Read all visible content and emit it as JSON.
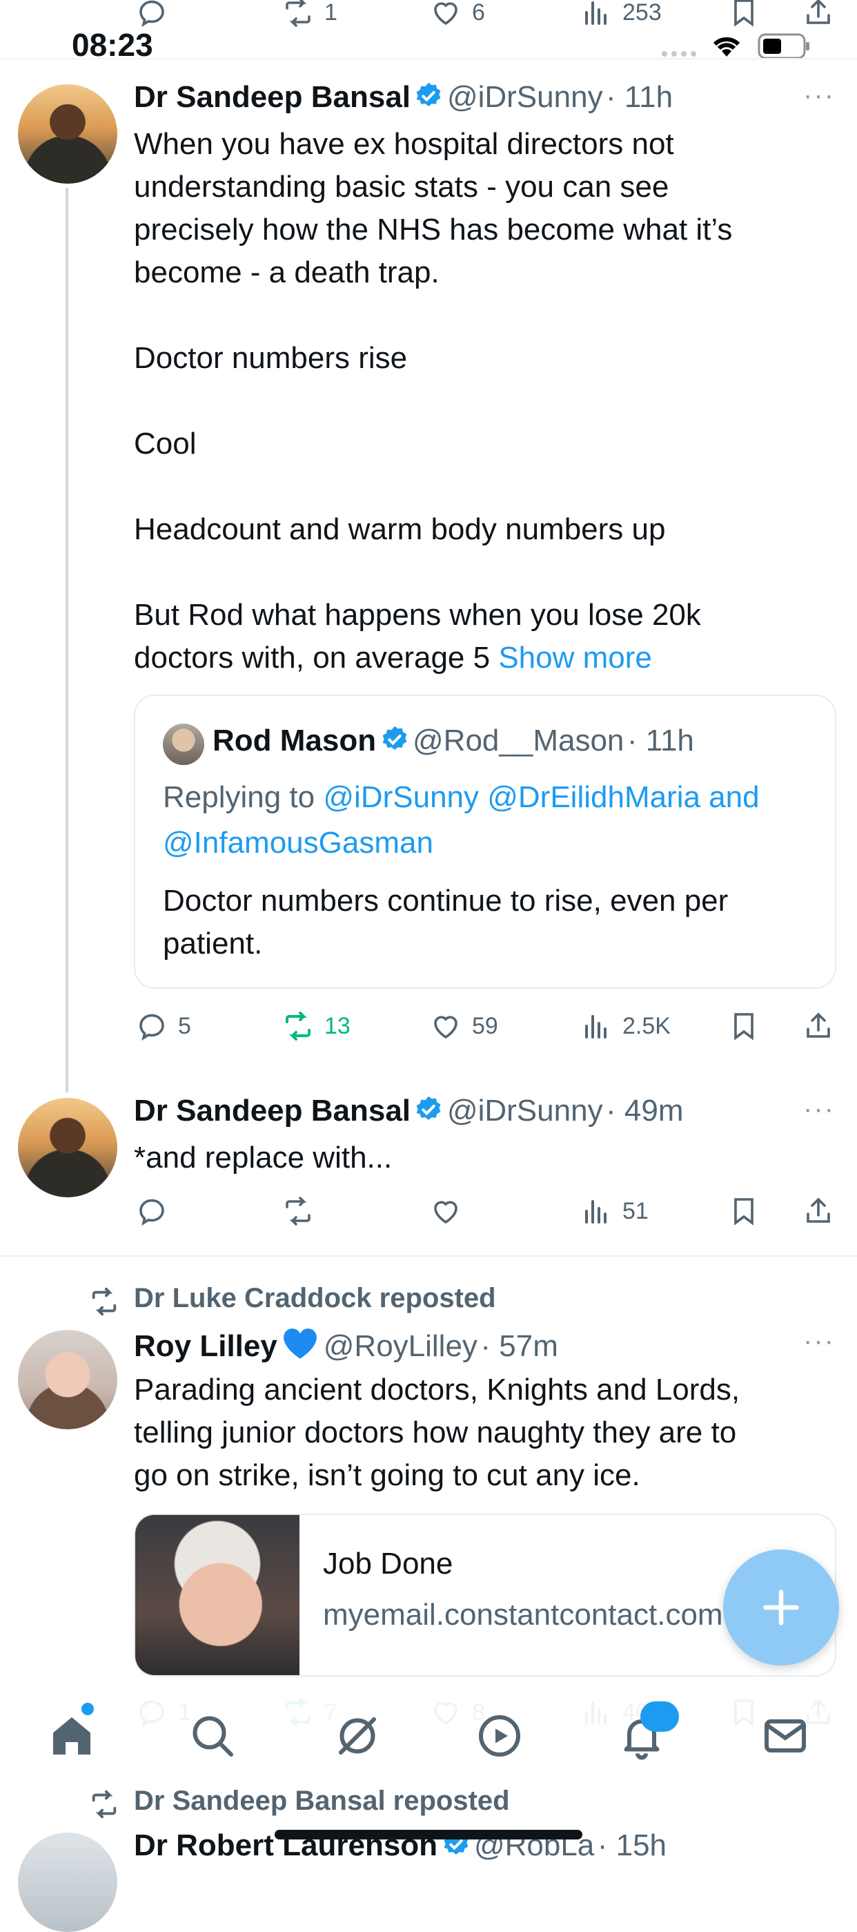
{
  "status_bar": {
    "time": "08:23"
  },
  "top_partial_tweet": {
    "reply_count": "",
    "repost_count": "1",
    "like_count": "6",
    "views_count": "253"
  },
  "tweet1": {
    "author": "Dr Sandeep Bansal",
    "handle": "@iDrSunny",
    "time": "· 11h",
    "text": "When you have ex hospital directors not\nunderstanding basic stats - you can see\nprecisely how the NHS has become what it’s\nbecome - a death trap.\n\nDoctor numbers rise\n\nCool\n\nHeadcount and warm body numbers up\n\nBut Rod what happens when you lose 20k\ndoctors with, on average 5",
    "show_more": "Show more",
    "quote": {
      "author": "Rod Mason",
      "handle": "@Rod__Mason",
      "time": "· 11h",
      "replying_prefix": "Replying to",
      "replying_users": "@iDrSunny @DrEilidhMaria and\n@InfamousGasman",
      "text": "Doctor numbers continue to rise, even per\npatient."
    },
    "reply_count": "5",
    "repost_count": "13",
    "like_count": "59",
    "views_count": "2.5K"
  },
  "tweet2": {
    "author": "Dr Sandeep Bansal",
    "handle": "@iDrSunny",
    "time": "· 49m",
    "text": "*and replace with...",
    "reply_count": "",
    "repost_count": "",
    "like_count": "",
    "views_count": "51"
  },
  "tweet3": {
    "reposted_by": "Dr Luke Craddock reposted",
    "author": "Roy Lilley",
    "handle": "@RoyLilley",
    "time": "· 57m",
    "text": "Parading ancient doctors, Knights and Lords,\ntelling junior doctors how naughty they are to\ngo on strike, isn’t going to cut any ice.",
    "card_title": "Job Done",
    "card_domain": "myemail.constantcontact.com",
    "reply_count": "1",
    "repost_count": "7",
    "like_count": "8",
    "views_count": "4078"
  },
  "tweet4": {
    "reposted_by": "Dr Sandeep Bansal reposted",
    "author": "Dr Robert Laurenson",
    "handle": "@RobLa",
    "time": "· 15h"
  },
  "tabbar": {
    "notification_badge": "",
    "tabs": [
      "home",
      "search",
      "grok",
      "video",
      "notifications",
      "messages"
    ]
  },
  "colors": {
    "accent": "#1d9bf0",
    "repost_green": "#00ba7c",
    "text": "#0f1419",
    "muted": "#536471"
  },
  "icons": [
    "reply-icon",
    "repost-icon",
    "like-icon",
    "views-icon",
    "bookmark-icon",
    "share-icon",
    "verified-icon",
    "more-icon",
    "compose-icon"
  ]
}
